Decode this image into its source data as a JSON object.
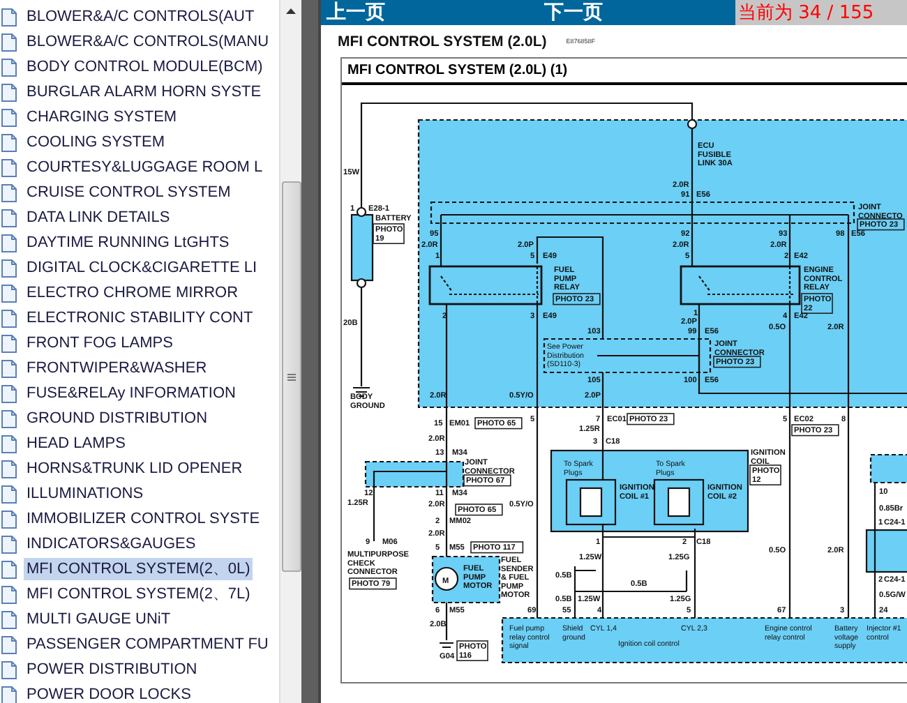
{
  "sidebar": {
    "items": [
      {
        "label": "BLOWER&A/C CONTROLS(AUT",
        "selected": false
      },
      {
        "label": "BLOWER&A/C CONTROLS(MANU",
        "selected": false
      },
      {
        "label": "BODY CONTROL MODULE(BCM)",
        "selected": false
      },
      {
        "label": "BURGLAR ALARM HORN SYSTE",
        "selected": false
      },
      {
        "label": "CHARGING SYSTEM",
        "selected": false
      },
      {
        "label": "COOLING SYSTEM",
        "selected": false
      },
      {
        "label": "COURTESY&LUGGAGE ROOM L",
        "selected": false
      },
      {
        "label": "CRUISE CONTROL SYSTEM",
        "selected": false
      },
      {
        "label": "DATA LINK DETAILS",
        "selected": false
      },
      {
        "label": "DAYTIME RUNNING LtGHTS",
        "selected": false
      },
      {
        "label": "DIGITAL CLOCK&CIGARETTE LI",
        "selected": false
      },
      {
        "label": "ELECTRO CHROME MIRROR",
        "selected": false
      },
      {
        "label": "ELECTRONIC STABILITY CONT",
        "selected": false
      },
      {
        "label": "FRONT FOG LAMPS",
        "selected": false
      },
      {
        "label": "FRONTWIPER&WASHER",
        "selected": false
      },
      {
        "label": "FUSE&RELAy INFORMATION",
        "selected": false
      },
      {
        "label": "GROUND DISTRIBUTION",
        "selected": false
      },
      {
        "label": "HEAD LAMPS",
        "selected": false
      },
      {
        "label": "HORNS&TRUNK LID OPENER",
        "selected": false
      },
      {
        "label": "ILLUMINATIONS",
        "selected": false
      },
      {
        "label": "IMMOBILIZER CONTROL SYSTE",
        "selected": false
      },
      {
        "label": "INDICATORS&GAUGES",
        "selected": false
      },
      {
        "label": "MFI CONTROL SYSTEM(2、0L)",
        "selected": true
      },
      {
        "label": "MFI CONTROL SYSTEM(2、7L)",
        "selected": false
      },
      {
        "label": "MULTI GAUGE UNiT",
        "selected": false
      },
      {
        "label": "PASSENGER COMPARTMENT FU",
        "selected": false
      },
      {
        "label": "POWER DISTRIBUTION",
        "selected": false
      },
      {
        "label": "POWER DOOR LOCKS",
        "selected": false
      }
    ]
  },
  "toolbar": {
    "prev": "上一页",
    "next": "下一页",
    "page_status": "当前为 34 / 155"
  },
  "document": {
    "title": "MFI CONTROL SYSTEM (2.0L)",
    "code": "E876858F",
    "diagram": {
      "title": "MFI CONTROL SYSTEM (2.0L) (1)",
      "labels": [
        {
          "kind": "label",
          "lines": [
            "ECU",
            "FUSIBLE",
            "LINK 30A"
          ]
        },
        {
          "kind": "label",
          "lines": [
            "15W"
          ]
        },
        {
          "kind": "label",
          "lines": [
            "1"
          ]
        },
        {
          "kind": "label",
          "lines": [
            "E28-1"
          ]
        },
        {
          "kind": "label",
          "lines": [
            "BATTERY"
          ]
        },
        {
          "kind": "tag",
          "lines": [
            "PHOTO",
            "19"
          ]
        },
        {
          "kind": "label",
          "lines": [
            "20B"
          ]
        },
        {
          "kind": "label",
          "lines": [
            "BODY",
            "GROUND"
          ]
        },
        {
          "kind": "label",
          "lines": [
            "2.0R"
          ]
        },
        {
          "kind": "label",
          "lines": [
            "91"
          ]
        },
        {
          "kind": "label",
          "lines": [
            "E56"
          ]
        },
        {
          "kind": "label",
          "lines": [
            "JOINT",
            "CONNECTO"
          ]
        },
        {
          "kind": "tag",
          "lines": [
            "PHOTO 23"
          ]
        },
        {
          "kind": "label",
          "lines": [
            "95"
          ]
        },
        {
          "kind": "label",
          "lines": [
            "2.0R"
          ]
        },
        {
          "kind": "label",
          "lines": [
            "92"
          ]
        },
        {
          "kind": "label",
          "lines": [
            "2.0R"
          ]
        },
        {
          "kind": "label",
          "lines": [
            "93"
          ]
        },
        {
          "kind": "label",
          "lines": [
            "2.0R"
          ]
        },
        {
          "kind": "label",
          "lines": [
            "98"
          ]
        },
        {
          "kind": "label",
          "lines": [
            "E56"
          ]
        },
        {
          "kind": "label",
          "lines": [
            "2.0P"
          ]
        },
        {
          "kind": "label",
          "lines": [
            "1"
          ]
        },
        {
          "kind": "label",
          "lines": [
            "5"
          ]
        },
        {
          "kind": "label",
          "lines": [
            "E49"
          ]
        },
        {
          "kind": "label",
          "lines": [
            "5"
          ]
        },
        {
          "kind": "label",
          "lines": [
            "2"
          ]
        },
        {
          "kind": "label",
          "lines": [
            "E42"
          ]
        },
        {
          "kind": "label",
          "lines": [
            "FUEL",
            "PUMP",
            "RELAY"
          ]
        },
        {
          "kind": "tag",
          "lines": [
            "PHOTO 23"
          ]
        },
        {
          "kind": "label",
          "lines": [
            "ENGINE",
            "CONTROL",
            "RELAY"
          ]
        },
        {
          "kind": "tag",
          "lines": [
            "PHOTO",
            "22"
          ]
        },
        {
          "kind": "label",
          "lines": [
            "2"
          ]
        },
        {
          "kind": "label",
          "lines": [
            "3"
          ]
        },
        {
          "kind": "label",
          "lines": [
            "E49"
          ]
        },
        {
          "kind": "label",
          "lines": [
            "1"
          ]
        },
        {
          "kind": "label",
          "lines": [
            "4"
          ]
        },
        {
          "kind": "label",
          "lines": [
            "E42"
          ]
        },
        {
          "kind": "label",
          "lines": [
            "2.0P"
          ]
        },
        {
          "kind": "label",
          "lines": [
            "0.5O"
          ]
        },
        {
          "kind": "label",
          "lines": [
            "2.0R"
          ]
        },
        {
          "kind": "label",
          "lines": [
            "103"
          ]
        },
        {
          "kind": "label",
          "lines": [
            "99"
          ]
        },
        {
          "kind": "label",
          "lines": [
            "E56"
          ]
        },
        {
          "kind": "note",
          "lines": [
            "See Power",
            "Distribution",
            "(SD110-3)"
          ]
        },
        {
          "kind": "label",
          "lines": [
            "JOINT",
            "CONNECTOR"
          ]
        },
        {
          "kind": "tag",
          "lines": [
            "PHOTO 23"
          ]
        },
        {
          "kind": "label",
          "lines": [
            "105"
          ]
        },
        {
          "kind": "label",
          "lines": [
            "100"
          ]
        },
        {
          "kind": "label",
          "lines": [
            "E56"
          ]
        },
        {
          "kind": "label",
          "lines": [
            "2.0R"
          ]
        },
        {
          "kind": "label",
          "lines": [
            "0.5Y/O"
          ]
        },
        {
          "kind": "label",
          "lines": [
            "2.0P"
          ]
        },
        {
          "kind": "label",
          "lines": [
            "15"
          ]
        },
        {
          "kind": "label",
          "lines": [
            "EM01"
          ]
        },
        {
          "kind": "tag",
          "lines": [
            "PHOTO 65"
          ]
        },
        {
          "kind": "label",
          "lines": [
            "5"
          ]
        },
        {
          "kind": "label",
          "lines": [
            "7"
          ]
        },
        {
          "kind": "label",
          "lines": [
            "EC01"
          ]
        },
        {
          "kind": "tag",
          "lines": [
            "PHOTO 23"
          ]
        },
        {
          "kind": "label",
          "lines": [
            "5"
          ]
        },
        {
          "kind": "label",
          "lines": [
            "EC02"
          ]
        },
        {
          "kind": "tag",
          "lines": [
            "PHOTO 23"
          ]
        },
        {
          "kind": "label",
          "lines": [
            "8"
          ]
        },
        {
          "kind": "label",
          "lines": [
            "1.25R"
          ]
        },
        {
          "kind": "label",
          "lines": [
            "3"
          ]
        },
        {
          "kind": "label",
          "lines": [
            "C18"
          ]
        },
        {
          "kind": "label",
          "lines": [
            "2.0R"
          ]
        },
        {
          "kind": "label",
          "lines": [
            "13"
          ]
        },
        {
          "kind": "label",
          "lines": [
            "M34"
          ]
        },
        {
          "kind": "label",
          "lines": [
            "JOINT",
            "CONNECTOR"
          ]
        },
        {
          "kind": "tag",
          "lines": [
            "PHOTO 67"
          ]
        },
        {
          "kind": "label",
          "lines": [
            "IGNITION",
            "COIL"
          ]
        },
        {
          "kind": "tag",
          "lines": [
            "PHOTO",
            "12"
          ]
        },
        {
          "kind": "note",
          "lines": [
            "To Spark",
            "Plugs"
          ]
        },
        {
          "kind": "note",
          "lines": [
            "To Spark",
            "Plugs"
          ]
        },
        {
          "kind": "label",
          "lines": [
            "12"
          ]
        },
        {
          "kind": "label",
          "lines": [
            "11"
          ]
        },
        {
          "kind": "label",
          "lines": [
            "M34"
          ]
        },
        {
          "kind": "label",
          "lines": [
            "IGNITION",
            "COIL #1"
          ]
        },
        {
          "kind": "label",
          "lines": [
            "IGNITION",
            "COIL #2"
          ]
        },
        {
          "kind": "label",
          "lines": [
            "1.25R"
          ]
        },
        {
          "kind": "label",
          "lines": [
            "2.0R"
          ]
        },
        {
          "kind": "tag",
          "lines": [
            "PHOTO 65"
          ]
        },
        {
          "kind": "label",
          "lines": [
            "0.5Y/O"
          ]
        },
        {
          "kind": "label",
          "lines": [
            "2"
          ]
        },
        {
          "kind": "label",
          "lines": [
            "MM02"
          ]
        },
        {
          "kind": "label",
          "lines": [
            "2.0R"
          ]
        },
        {
          "kind": "label",
          "lines": [
            "9"
          ]
        },
        {
          "kind": "label",
          "lines": [
            "M06"
          ]
        },
        {
          "kind": "label",
          "lines": [
            "5"
          ]
        },
        {
          "kind": "label",
          "lines": [
            "M55"
          ]
        },
        {
          "kind": "tag",
          "lines": [
            "PHOTO 117"
          ]
        },
        {
          "kind": "label",
          "lines": [
            "MULTIPURPOSE",
            "CHECK",
            "CONNECTOR"
          ]
        },
        {
          "kind": "tag",
          "lines": [
            "PHOTO 79"
          ]
        },
        {
          "kind": "label",
          "lines": [
            "1"
          ]
        },
        {
          "kind": "label",
          "lines": [
            "2"
          ]
        },
        {
          "kind": "label",
          "lines": [
            "C18"
          ]
        },
        {
          "kind": "label",
          "lines": [
            "1.25W"
          ]
        },
        {
          "kind": "label",
          "lines": [
            "1.25G"
          ]
        },
        {
          "kind": "label",
          "lines": [
            "0.5O"
          ]
        },
        {
          "kind": "label",
          "lines": [
            "2.0R"
          ]
        },
        {
          "kind": "label",
          "lines": [
            "M"
          ]
        },
        {
          "kind": "label",
          "lines": [
            "FUEL",
            "PUMP",
            "MOTOR"
          ]
        },
        {
          "kind": "label",
          "lines": [
            "FUEL",
            "SENDER",
            "& FUEL",
            "PUMP",
            "MOTOR"
          ]
        },
        {
          "kind": "label",
          "lines": [
            "0.5B"
          ]
        },
        {
          "kind": "label",
          "lines": [
            "0.5B"
          ]
        },
        {
          "kind": "label",
          "lines": [
            "0.5B"
          ]
        },
        {
          "kind": "label",
          "lines": [
            "1.25W"
          ]
        },
        {
          "kind": "label",
          "lines": [
            "1.25G"
          ]
        },
        {
          "kind": "label",
          "lines": [
            "10"
          ]
        },
        {
          "kind": "label",
          "lines": [
            "0.85Br"
          ]
        },
        {
          "kind": "label",
          "lines": [
            "1"
          ]
        },
        {
          "kind": "label",
          "lines": [
            "C24-1"
          ]
        },
        {
          "kind": "label",
          "lines": [
            "2"
          ]
        },
        {
          "kind": "label",
          "lines": [
            "C24-1"
          ]
        },
        {
          "kind": "label",
          "lines": [
            "0.5G/W"
          ]
        },
        {
          "kind": "label",
          "lines": [
            "6"
          ]
        },
        {
          "kind": "label",
          "lines": [
            "M55"
          ]
        },
        {
          "kind": "label",
          "lines": [
            "69"
          ]
        },
        {
          "kind": "label",
          "lines": [
            "55"
          ]
        },
        {
          "kind": "label",
          "lines": [
            "4"
          ]
        },
        {
          "kind": "label",
          "lines": [
            "5"
          ]
        },
        {
          "kind": "label",
          "lines": [
            "67"
          ]
        },
        {
          "kind": "label",
          "lines": [
            "3"
          ]
        },
        {
          "kind": "label",
          "lines": [
            "24"
          ]
        },
        {
          "kind": "label",
          "lines": [
            "2.0B"
          ]
        },
        {
          "kind": "label",
          "lines": [
            "G04"
          ]
        },
        {
          "kind": "tag",
          "lines": [
            "PHOTO",
            "116"
          ]
        },
        {
          "kind": "note",
          "lines": [
            "Fuel pump",
            "relay control",
            "signal"
          ]
        },
        {
          "kind": "note",
          "lines": [
            "Shield",
            "ground"
          ]
        },
        {
          "kind": "note",
          "lines": [
            "CYL 1,4"
          ]
        },
        {
          "kind": "note",
          "lines": [
            "CYL 2,3"
          ]
        },
        {
          "kind": "note",
          "lines": [
            "Ignition coil control"
          ]
        },
        {
          "kind": "note",
          "lines": [
            "Engine control",
            "relay control"
          ]
        },
        {
          "kind": "note",
          "lines": [
            "Battery",
            "voltage",
            "supply"
          ]
        },
        {
          "kind": "note",
          "lines": [
            "Injector #1",
            "control"
          ]
        }
      ]
    }
  }
}
